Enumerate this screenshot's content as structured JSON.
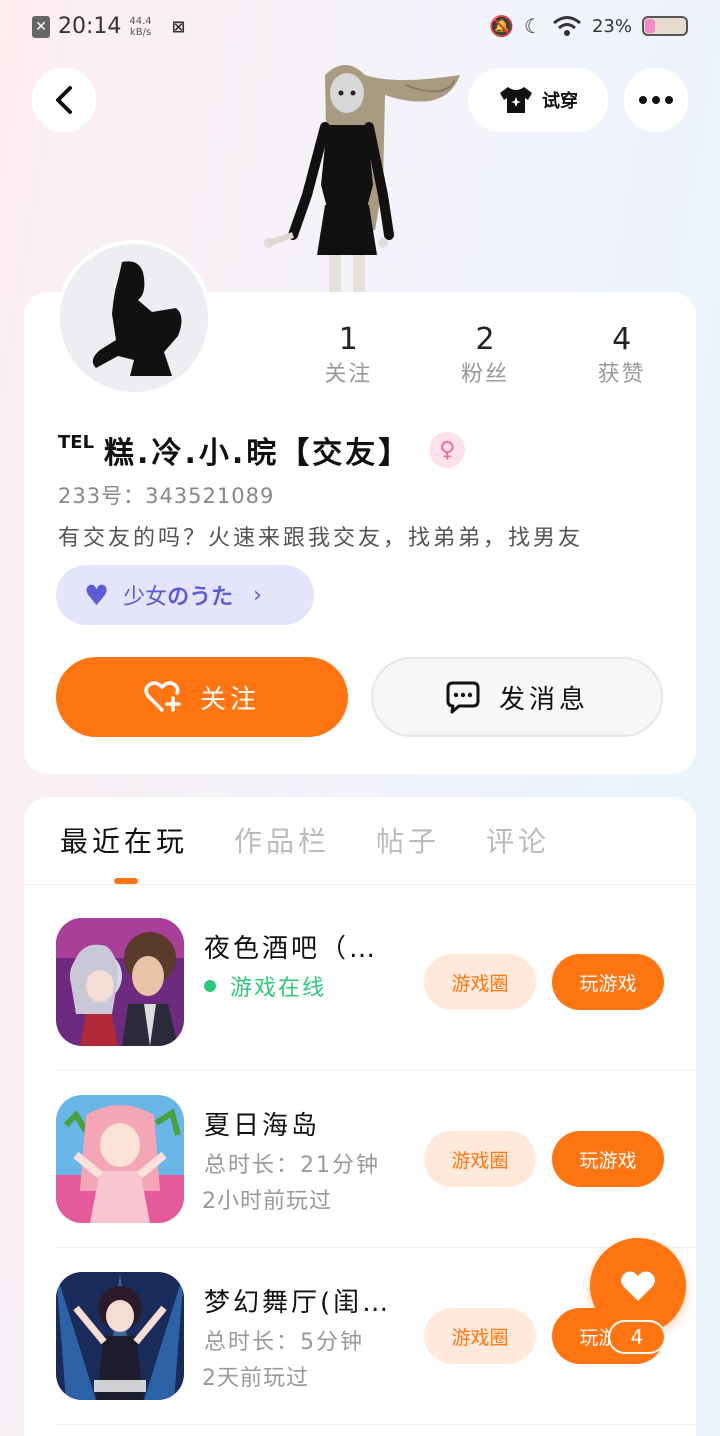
{
  "status_bar": {
    "time": "20:14",
    "speed_value": "44.4",
    "speed_unit": "kB/s",
    "battery_text": "23%",
    "battery_level": 0.23
  },
  "header": {
    "try_on_label": "试穿"
  },
  "profile": {
    "name_prefix": "TEL",
    "name": "糕.冷.小.晥【交友】",
    "gender_symbol": "♀",
    "user_id": "233号：343521089",
    "bio": "有交友的吗？火速来跟我交友，找弟弟，找男友",
    "stats": [
      {
        "value": "1",
        "label": "关注"
      },
      {
        "value": "2",
        "label": "粉丝"
      },
      {
        "value": "4",
        "label": "获赞"
      }
    ],
    "song": {
      "prefix": "少女",
      "suffix": "のうた"
    },
    "follow_label": "关注",
    "message_label": "发消息"
  },
  "tabs": [
    {
      "label": "最近在玩",
      "active": true
    },
    {
      "label": "作品栏",
      "active": false
    },
    {
      "label": "帖子",
      "active": false
    },
    {
      "label": "评论",
      "active": false
    }
  ],
  "games": [
    {
      "title": "夜色酒吧（…",
      "line1": "游戏在线",
      "line2": "",
      "online": true,
      "circle_label": "游戏圈",
      "play_label": "玩游戏"
    },
    {
      "title": "夏日海岛",
      "line1": "总时长：21分钟",
      "line2": "2小时前玩过",
      "online": false,
      "circle_label": "游戏圈",
      "play_label": "玩游戏"
    },
    {
      "title": "梦幻舞厅(闺…",
      "line1": "总时长：5分钟",
      "line2": "2天前玩过",
      "online": false,
      "circle_label": "游戏圈",
      "play_label": "玩游戏"
    }
  ],
  "like_fab": {
    "count": "4"
  },
  "colors": {
    "accent": "#ff7511",
    "online": "#2fc87c",
    "song": "#5b5bd6"
  }
}
